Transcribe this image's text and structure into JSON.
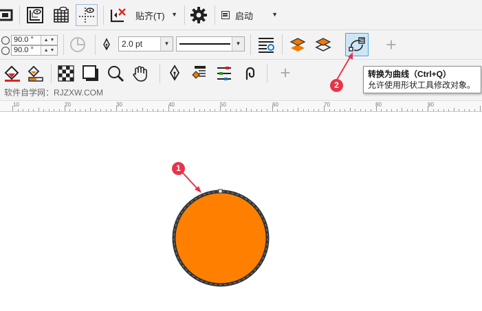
{
  "toolbar_top": {
    "snap_label": "贴齐(T)",
    "launch_label": "启动"
  },
  "property_bar": {
    "angle_1": "90.0 °",
    "angle_2": "90.0 °",
    "outline_width": "2.0 pt"
  },
  "toolbar_left": {
    "add_label": "+"
  },
  "website_label": "软件自学网：RJZXW.COM",
  "ruler": {
    "labels": [
      "10",
      "20",
      "30",
      "40",
      "50",
      "60",
      "70",
      "80",
      "90"
    ]
  },
  "tooltip": {
    "title": "转换为曲线（Ctrl+Q）",
    "description": "允许使用形状工具修改对象。"
  },
  "annotations": {
    "marker_1": "1",
    "marker_2": "2"
  },
  "colors": {
    "shape_fill": "#FF8000",
    "shape_outline": "#333333",
    "marker": "#E8344A",
    "highlight": "#1E90FF"
  },
  "icons": [
    "crop-icon",
    "ruler-view-icon",
    "grid-icon",
    "guidelines-icon",
    "delete-snap-icon",
    "gear-icon",
    "launch-icon",
    "pie-icon",
    "pen-nib-icon",
    "text-wrap-icon",
    "layer-front-icon",
    "layer-back-icon",
    "convert-to-curves-icon",
    "plus-icon",
    "fill-bucket-icon",
    "interactive-fill-icon",
    "checker-transparency-icon",
    "drop-shadow-icon",
    "zoom-icon",
    "hand-pan-icon",
    "pen-tool-icon",
    "object-manager-icon",
    "align-distribute-icon",
    "spiral-icon"
  ]
}
